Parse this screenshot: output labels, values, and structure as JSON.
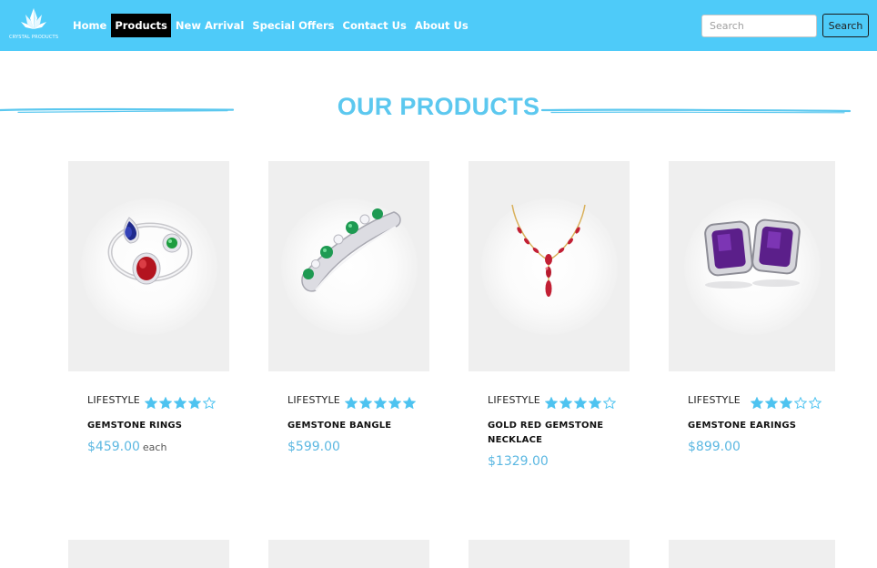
{
  "brand": {
    "logo_text": "CRYSTAL PRODUCTS"
  },
  "nav": {
    "items": [
      {
        "label": "Home"
      },
      {
        "label": "Products"
      },
      {
        "label": "New Arrival"
      },
      {
        "label": "Special Offers"
      },
      {
        "label": "Contact Us"
      },
      {
        "label": "About Us"
      }
    ],
    "active": "Products"
  },
  "search": {
    "placeholder": "Search",
    "value": "",
    "button_label": "Search"
  },
  "section": {
    "title": "OUR PRODUCTS"
  },
  "colors": {
    "nav_bg": "#4ecbf9",
    "accent": "#5cc8ef",
    "price": "#5cb8e2",
    "star": "#4ec3f0"
  },
  "products": [
    {
      "category": "LIFESTYLE",
      "name": "GEMSTONE RINGS",
      "price": "$459.00",
      "unit": "each",
      "rating": 4,
      "max_rating": 5,
      "image_icon": "gemstone-rings-image"
    },
    {
      "category": "LIFESTYLE",
      "name": "GEMSTONE BANGLE",
      "price": "$599.00",
      "unit": "",
      "rating": 5,
      "max_rating": 5,
      "image_icon": "gemstone-bangle-image"
    },
    {
      "category": "LIFESTYLE",
      "name": "GOLD RED GEMSTONE NECKLACE",
      "price": "$1329.00",
      "unit": "",
      "rating": 4,
      "max_rating": 5,
      "image_icon": "gold-necklace-image"
    },
    {
      "category": "LIFESTYLE",
      "name": "GEMSTONE EARINGS",
      "price": "$899.00",
      "unit": "",
      "rating": 3,
      "max_rating": 5,
      "image_icon": "gemstone-earrings-image"
    }
  ]
}
